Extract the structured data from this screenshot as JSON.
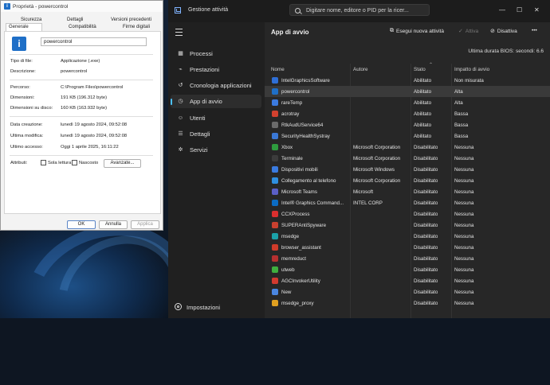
{
  "props": {
    "title": "Proprietà - powercontrol",
    "tabs_row1": [
      "Sicurezza",
      "Dettagli",
      "Versioni precedenti"
    ],
    "tabs_row2": [
      "Generale",
      "Compatibilità",
      "Firme digitali"
    ],
    "filename": "powercontrol",
    "fields": [
      {
        "label": "Tipo di file:",
        "value": "Applicazione (.exe)"
      },
      {
        "label": "Descrizione:",
        "value": "powercontrol"
      },
      {
        "label": "Percorso:",
        "value": "C:\\Program Files\\powercontrol"
      },
      {
        "label": "Dimensioni:",
        "value": "191 KB (196.312 byte)"
      },
      {
        "label": "Dimensioni su disco:",
        "value": "160 KB (163.932 byte)"
      },
      {
        "label": "Data creazione:",
        "value": "lunedì 19 agosto 2024, 09:52:08"
      },
      {
        "label": "Ultima modifica:",
        "value": "lunedì 19 agosto 2024, 09:52:08"
      },
      {
        "label": "Ultimo accesso:",
        "value": "Oggi 1 aprile 2025, 16:11:22"
      }
    ],
    "attributes_label": "Attributi:",
    "readonly_label": "Sola lettura",
    "hidden_label": "Nascosto",
    "advanced_label": "Avanzate...",
    "ok_label": "OK",
    "cancel_label": "Annulla",
    "apply_label": "Applica"
  },
  "tm": {
    "title": "Gestione attività",
    "search_placeholder": "Digitare nome, editore o PID per la ricer...",
    "win_min": "—",
    "win_max": "☐",
    "win_close": "✕",
    "nav": [
      {
        "label": "Processi",
        "icon": "grid-icon",
        "glyph": "▦"
      },
      {
        "label": "Prestazioni",
        "icon": "performance-icon",
        "glyph": "⌁"
      },
      {
        "label": "Cronologia applicazioni",
        "icon": "history-icon",
        "glyph": "↺"
      },
      {
        "label": "App di avvio",
        "icon": "startup-icon",
        "glyph": "◷"
      },
      {
        "label": "Utenti",
        "icon": "users-icon",
        "glyph": "☺"
      },
      {
        "label": "Dettagli",
        "icon": "details-icon",
        "glyph": "☰"
      },
      {
        "label": "Servizi",
        "icon": "services-icon",
        "glyph": "✲"
      }
    ],
    "settings_label": "Impostazioni",
    "page_title": "App di avvio",
    "btn_new_task": "Esegui nuova attività",
    "btn_enable": "Attiva",
    "btn_disable": "Disattiva",
    "btn_more": "•••",
    "bios_label": "Ultima durata BIOS:",
    "bios_value": "secondi: 6.6",
    "columns": [
      "Nome",
      "Autore",
      "Stato",
      "Impatto di avvio"
    ],
    "rows": [
      {
        "name": "IntelGraphicsSoftware",
        "publisher": "",
        "status": "Abilitato",
        "impact": "Non misurata",
        "color": "#2f6fd6"
      },
      {
        "name": "powercontrol",
        "publisher": "",
        "status": "Abilitato",
        "impact": "Alta",
        "color": "#1f6fc7"
      },
      {
        "name": "rareTemp",
        "publisher": "",
        "status": "Abilitato",
        "impact": "Alta",
        "color": "#3b7be0"
      },
      {
        "name": "acrotray",
        "publisher": "",
        "status": "Abilitato",
        "impact": "Bassa",
        "color": "#d2412f"
      },
      {
        "name": "RtkAudUService64",
        "publisher": "",
        "status": "Abilitato",
        "impact": "Bassa",
        "color": "#6b6b6b"
      },
      {
        "name": "SecurityHealthSystray",
        "publisher": "",
        "status": "Abilitato",
        "impact": "Bassa",
        "color": "#3a78d6"
      },
      {
        "name": "Xbox",
        "publisher": "Microsoft Corporation",
        "status": "Disabilitato",
        "impact": "Nessuna",
        "color": "#2e9b3e"
      },
      {
        "name": "Terminale",
        "publisher": "Microsoft Corporation",
        "status": "Disabilitato",
        "impact": "Nessuna",
        "color": "#3c3c3c"
      },
      {
        "name": "Dispositivi mobili",
        "publisher": "Microsoft Windows",
        "status": "Disabilitato",
        "impact": "Nessuna",
        "color": "#3a7be0"
      },
      {
        "name": "Collegamento al telefono",
        "publisher": "Microsoft Corporation",
        "status": "Disabilitato",
        "impact": "Nessuna",
        "color": "#2f8fe0"
      },
      {
        "name": "Microsoft Teams",
        "publisher": "Microsoft",
        "status": "Disabilitato",
        "impact": "Nessuna",
        "color": "#5b5fc7"
      },
      {
        "name": "Intel® Graphics Command...",
        "publisher": "INTEL CORP",
        "status": "Disabilitato",
        "impact": "Nessuna",
        "color": "#0b6cc4"
      },
      {
        "name": "CCXProcess",
        "publisher": "",
        "status": "Disabilitato",
        "impact": "Nessuna",
        "color": "#da2f2f"
      },
      {
        "name": "SUPERAntiSpyware",
        "publisher": "",
        "status": "Disabilitato",
        "impact": "Nessuna",
        "color": "#c9402f"
      },
      {
        "name": "msedge",
        "publisher": "",
        "status": "Disabilitato",
        "impact": "Nessuna",
        "color": "#1ba1a8"
      },
      {
        "name": "browser_assistant",
        "publisher": "",
        "status": "Disabilitato",
        "impact": "Nessuna",
        "color": "#cf3b2a"
      },
      {
        "name": "memreduct",
        "publisher": "",
        "status": "Disabilitato",
        "impact": "Nessuna",
        "color": "#b53030"
      },
      {
        "name": "utweb",
        "publisher": "",
        "status": "Disabilitato",
        "impact": "Nessuna",
        "color": "#3fae3f"
      },
      {
        "name": "AGCInvokerUtility",
        "publisher": "",
        "status": "Disabilitato",
        "impact": "Nessuna",
        "color": "#d23a2f"
      },
      {
        "name": "New",
        "publisher": "",
        "status": "Disabilitato",
        "impact": "Nessuna",
        "color": "#4a86e0"
      },
      {
        "name": "msedge_proxy",
        "publisher": "",
        "status": "Disabilitato",
        "impact": "Nessuna",
        "color": "#e0a020"
      }
    ]
  }
}
